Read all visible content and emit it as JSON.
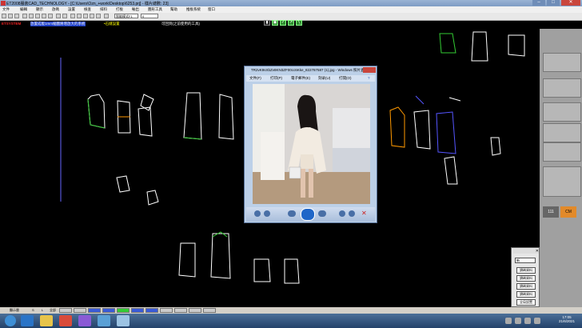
{
  "window": {
    "title": "ET2008服裝CAD_TECHNOLOGY - [C:\\Users\\Ozn_+work\\Desktop\\6253.prj] - 樣片總數: 23]",
    "controls": [
      "minimize",
      "maximize",
      "close"
    ]
  },
  "menubar": {
    "items": [
      "文件",
      "編輯",
      "顯示",
      "放碼",
      "設置",
      "檢查",
      "排料",
      "打板",
      "輸出",
      "圖形工具",
      "幫助",
      "推板系統",
      "窗口"
    ]
  },
  "toolbar": {
    "mode_select": "智能模式F1",
    "size_select": "0"
  },
  "banner": {
    "brand": "ETSYSTEM",
    "text": "放置成版1mm縮圖將增放大的系統",
    "extra": "•石縫設置",
    "note": "可回到(之前使用的工具)"
  },
  "viewer": {
    "title": "TR2vK9sXbZv8KN3ZF00cc6Kke_822787587 (1).jpg - Windows 照片查看器",
    "menu": [
      "文件(F)",
      "打印(P)",
      "電子郵件(E)",
      "刻录(U)",
      "打開(O)"
    ],
    "help_icon": "help-icon"
  },
  "dialog": {
    "select_value": "新",
    "buttons": [
      "讀碼資料",
      "讀碼資料",
      "讀碼資料",
      "讀碼資料",
      "全局設置"
    ]
  },
  "statusbar": {
    "left": "顯示層",
    "size_a": "S",
    "size_b": "L",
    "all_label": "全部",
    "extra": ""
  },
  "taskbar": {
    "time": "17:05",
    "date": "21/6/2021"
  },
  "colors": {
    "accent": "#1a3cc8",
    "pattern_green": "#3c3",
    "pattern_white": "#fff",
    "pattern_blue": "#55f",
    "pattern_orange": "#f90"
  }
}
